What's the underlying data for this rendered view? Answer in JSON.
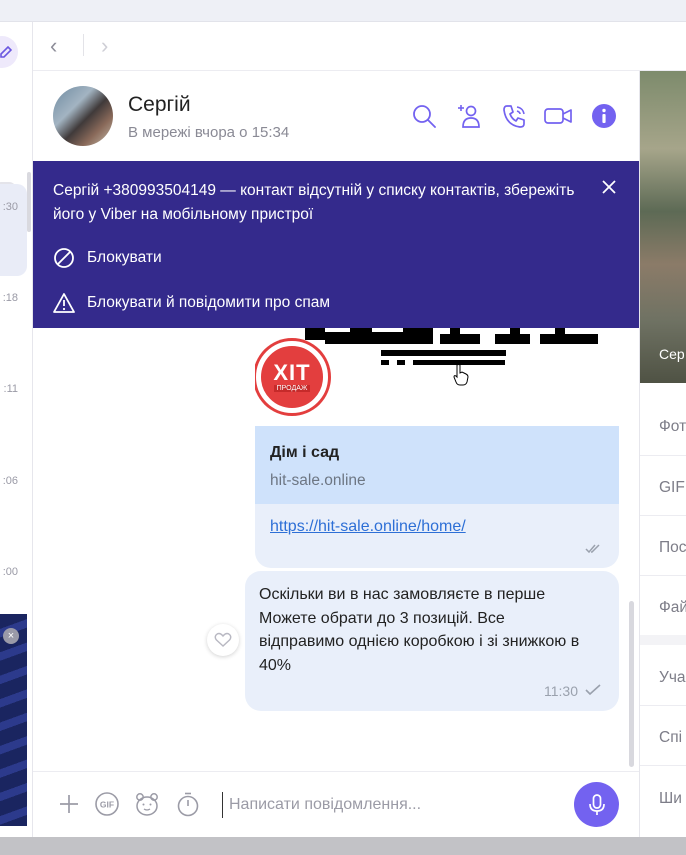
{
  "left_list": {
    "times": [
      ":30",
      ":18",
      ":11",
      ":06",
      ":00"
    ],
    "ad_close": "×",
    "more_badge": "•••"
  },
  "nav": {
    "back": "‹",
    "forward": "›"
  },
  "header": {
    "name": "Сергій",
    "status": "В мережі вчора о 15:34"
  },
  "banner": {
    "text": "Сергій +380993504149 — контакт відсутній у списку контактів, збережіть його у Viber на мобільному пристрої",
    "block_label": "Блокувати",
    "block_report_label": "Блокувати й повідомити про спам"
  },
  "messages": [
    {
      "type": "link",
      "badge_main": "ХІТ",
      "badge_sub": "ПРОДАЖ",
      "title": "Дім і сад",
      "domain": "hit-sale.online",
      "url": "https://hit-sale.online/home/"
    },
    {
      "type": "text",
      "text": "Оскільки ви в нас замовляєте в перше Можете обрати до 3 позицій. Все відправимо однією коробкою і зі знижкою в 40%",
      "time": "11:30"
    }
  ],
  "composer": {
    "placeholder": "Написати повідомлення..."
  },
  "right_panel": {
    "photo_label": "Сер",
    "items": [
      "Фот",
      "GIF",
      "Пос",
      "Фай",
      "Уча",
      "Спі",
      "Ши"
    ]
  },
  "colors": {
    "accent": "#7362f0",
    "banner": "#342a8c",
    "bubble": "#e9effa",
    "link": "#2d6fd6",
    "icon": "#7362f0"
  }
}
